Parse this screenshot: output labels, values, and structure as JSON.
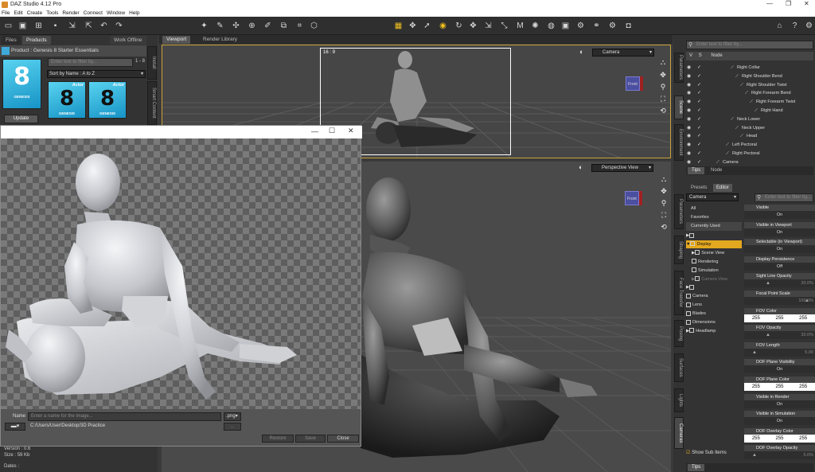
{
  "app": {
    "title": "DAZ Studio 4.12 Pro"
  },
  "menu": [
    "File",
    "Edit",
    "Create",
    "Tools",
    "Render",
    "Connect",
    "Window",
    "Help"
  ],
  "left": {
    "tabs": [
      "Files",
      "Products",
      "Work Offline"
    ],
    "product_header": "Product : Genesis 8 Starter Essentials",
    "filter_placeholder": "Enter text to filter by...",
    "count": "1 - 8",
    "sort": "Sort by Name : A to Z",
    "genesis_label": "GENESIS",
    "actor_label": "Actor",
    "update_button": "Update",
    "side_tabs": [
      "Install",
      "Smart Content"
    ],
    "meta": [
      {
        "k": "Version :",
        "v": "0.6"
      },
      {
        "k": "Size :",
        "v": "59 Kb"
      },
      {
        "k": "Dates :",
        "v": ""
      }
    ]
  },
  "viewport": {
    "tabs": [
      "Viewport",
      "Render Library"
    ],
    "aspect": "16 : 9",
    "top_camera": "Camera",
    "bottom_camera": "Perspective View",
    "gizmo_label": "Front"
  },
  "render_window": {
    "name_label": "Name",
    "name_placeholder": "Enter a name for the image...",
    "format": ".png",
    "path": "C:/Users/User/Desktop/3D Practice",
    "browse": "...",
    "buttons": [
      "Restore",
      "Save",
      "Close"
    ]
  },
  "scene": {
    "filter_placeholder": "Enter text to filter by...",
    "columns": [
      "V",
      "S",
      "Node"
    ],
    "side_tabs": [
      "Parameters",
      "Scene",
      "Environment"
    ],
    "nodes": [
      {
        "label": "Right Collar",
        "depth": 0
      },
      {
        "label": "Right Shoulder Bend",
        "depth": 1
      },
      {
        "label": "Right Shoulder Twist",
        "depth": 2
      },
      {
        "label": "Right Forearm Bend",
        "depth": 3
      },
      {
        "label": "Right Forearm Twist",
        "depth": 4
      },
      {
        "label": "Right Hand",
        "depth": 5
      },
      {
        "label": "Neck Lower",
        "depth": 0
      },
      {
        "label": "Neck Upper",
        "depth": 1
      },
      {
        "label": "Head",
        "depth": 2
      },
      {
        "label": "Left Pectoral",
        "depth": -1
      },
      {
        "label": "Right Pectoral",
        "depth": -1
      },
      {
        "label": "Camera",
        "depth": -3
      }
    ]
  },
  "props": {
    "tabs": [
      "Tips",
      "Node"
    ],
    "subtabs": [
      "Presets",
      "Editor"
    ],
    "dropdown": "Camera",
    "filter_placeholder": "Enter text to filter by...",
    "filters": [
      "All",
      "Favorites",
      "Currently Used"
    ],
    "tree": [
      {
        "label": "",
        "indent": 0,
        "arrow": "▶"
      },
      {
        "label": "Display",
        "indent": 0,
        "arrow": "▼",
        "selected": true
      },
      {
        "label": "Scene View",
        "indent": 1,
        "arrow": "▶"
      },
      {
        "label": "Rendering",
        "indent": 1,
        "arrow": ""
      },
      {
        "label": "Simulation",
        "indent": 1,
        "arrow": ""
      },
      {
        "label": "Camera View",
        "indent": 1,
        "arrow": "▶",
        "dim": true
      },
      {
        "label": "",
        "indent": 0,
        "arrow": "▶"
      },
      {
        "label": "Camera",
        "indent": 0,
        "arrow": ""
      },
      {
        "label": "Lens",
        "indent": 0,
        "arrow": ""
      },
      {
        "label": "Blades",
        "indent": 0,
        "arrow": ""
      },
      {
        "label": "Dimensions",
        "indent": 0,
        "arrow": ""
      },
      {
        "label": "Headlamp",
        "indent": 0,
        "arrow": "▶"
      }
    ],
    "show_sub_items": "Show Sub Items",
    "side_tabs": [
      "Parameters",
      "Shaping",
      "Face Transfer",
      "Posing",
      "Surfaces",
      "Lights",
      "Cameras"
    ],
    "bottom_tab": "Tips",
    "params": [
      {
        "label": "Visible",
        "value": "On",
        "kind": "toggle"
      },
      {
        "label": "Visible in Viewport",
        "value": "On",
        "kind": "toggle"
      },
      {
        "label": "Selectable (in Viewport)",
        "value": "On",
        "kind": "toggle"
      },
      {
        "label": "Display Persistence",
        "value": "Off",
        "kind": "toggle"
      },
      {
        "label": "Sight Line Opacity",
        "value": "30.0%",
        "kind": "slider",
        "fraction": 0.3
      },
      {
        "label": "Focal Point Scale",
        "value": "100.0%",
        "kind": "slider",
        "fraction": 1.0
      },
      {
        "label": "FOV Color",
        "rgb": [
          "255",
          "255",
          "255"
        ],
        "kind": "rgb"
      },
      {
        "label": "FOV Opacity",
        "value": "30.0%",
        "kind": "slider",
        "fraction": 0.3
      },
      {
        "label": "FOV Length",
        "value": "5.00",
        "kind": "slider",
        "fraction": 0.05
      },
      {
        "label": "DOF Plane Visibility",
        "value": "On",
        "kind": "toggle"
      },
      {
        "label": "DOF Plane Color",
        "rgb": [
          "255",
          "255",
          "255"
        ],
        "kind": "rgb"
      },
      {
        "label": "Visible in Render",
        "value": "On",
        "kind": "toggle"
      },
      {
        "label": "Visible in Simulation",
        "value": "On",
        "kind": "toggle"
      },
      {
        "label": "DOF Overlay Color",
        "rgb": [
          "255",
          "255",
          "255"
        ],
        "kind": "rgb"
      },
      {
        "label": "DOF Overlay Opacity",
        "value": "5.0%",
        "kind": "slider",
        "fraction": 0.05
      }
    ]
  },
  "colors": {
    "accent": "#e3a81f",
    "viewport_border": "#c8a23a",
    "product_blue": "#3fa9d9"
  }
}
